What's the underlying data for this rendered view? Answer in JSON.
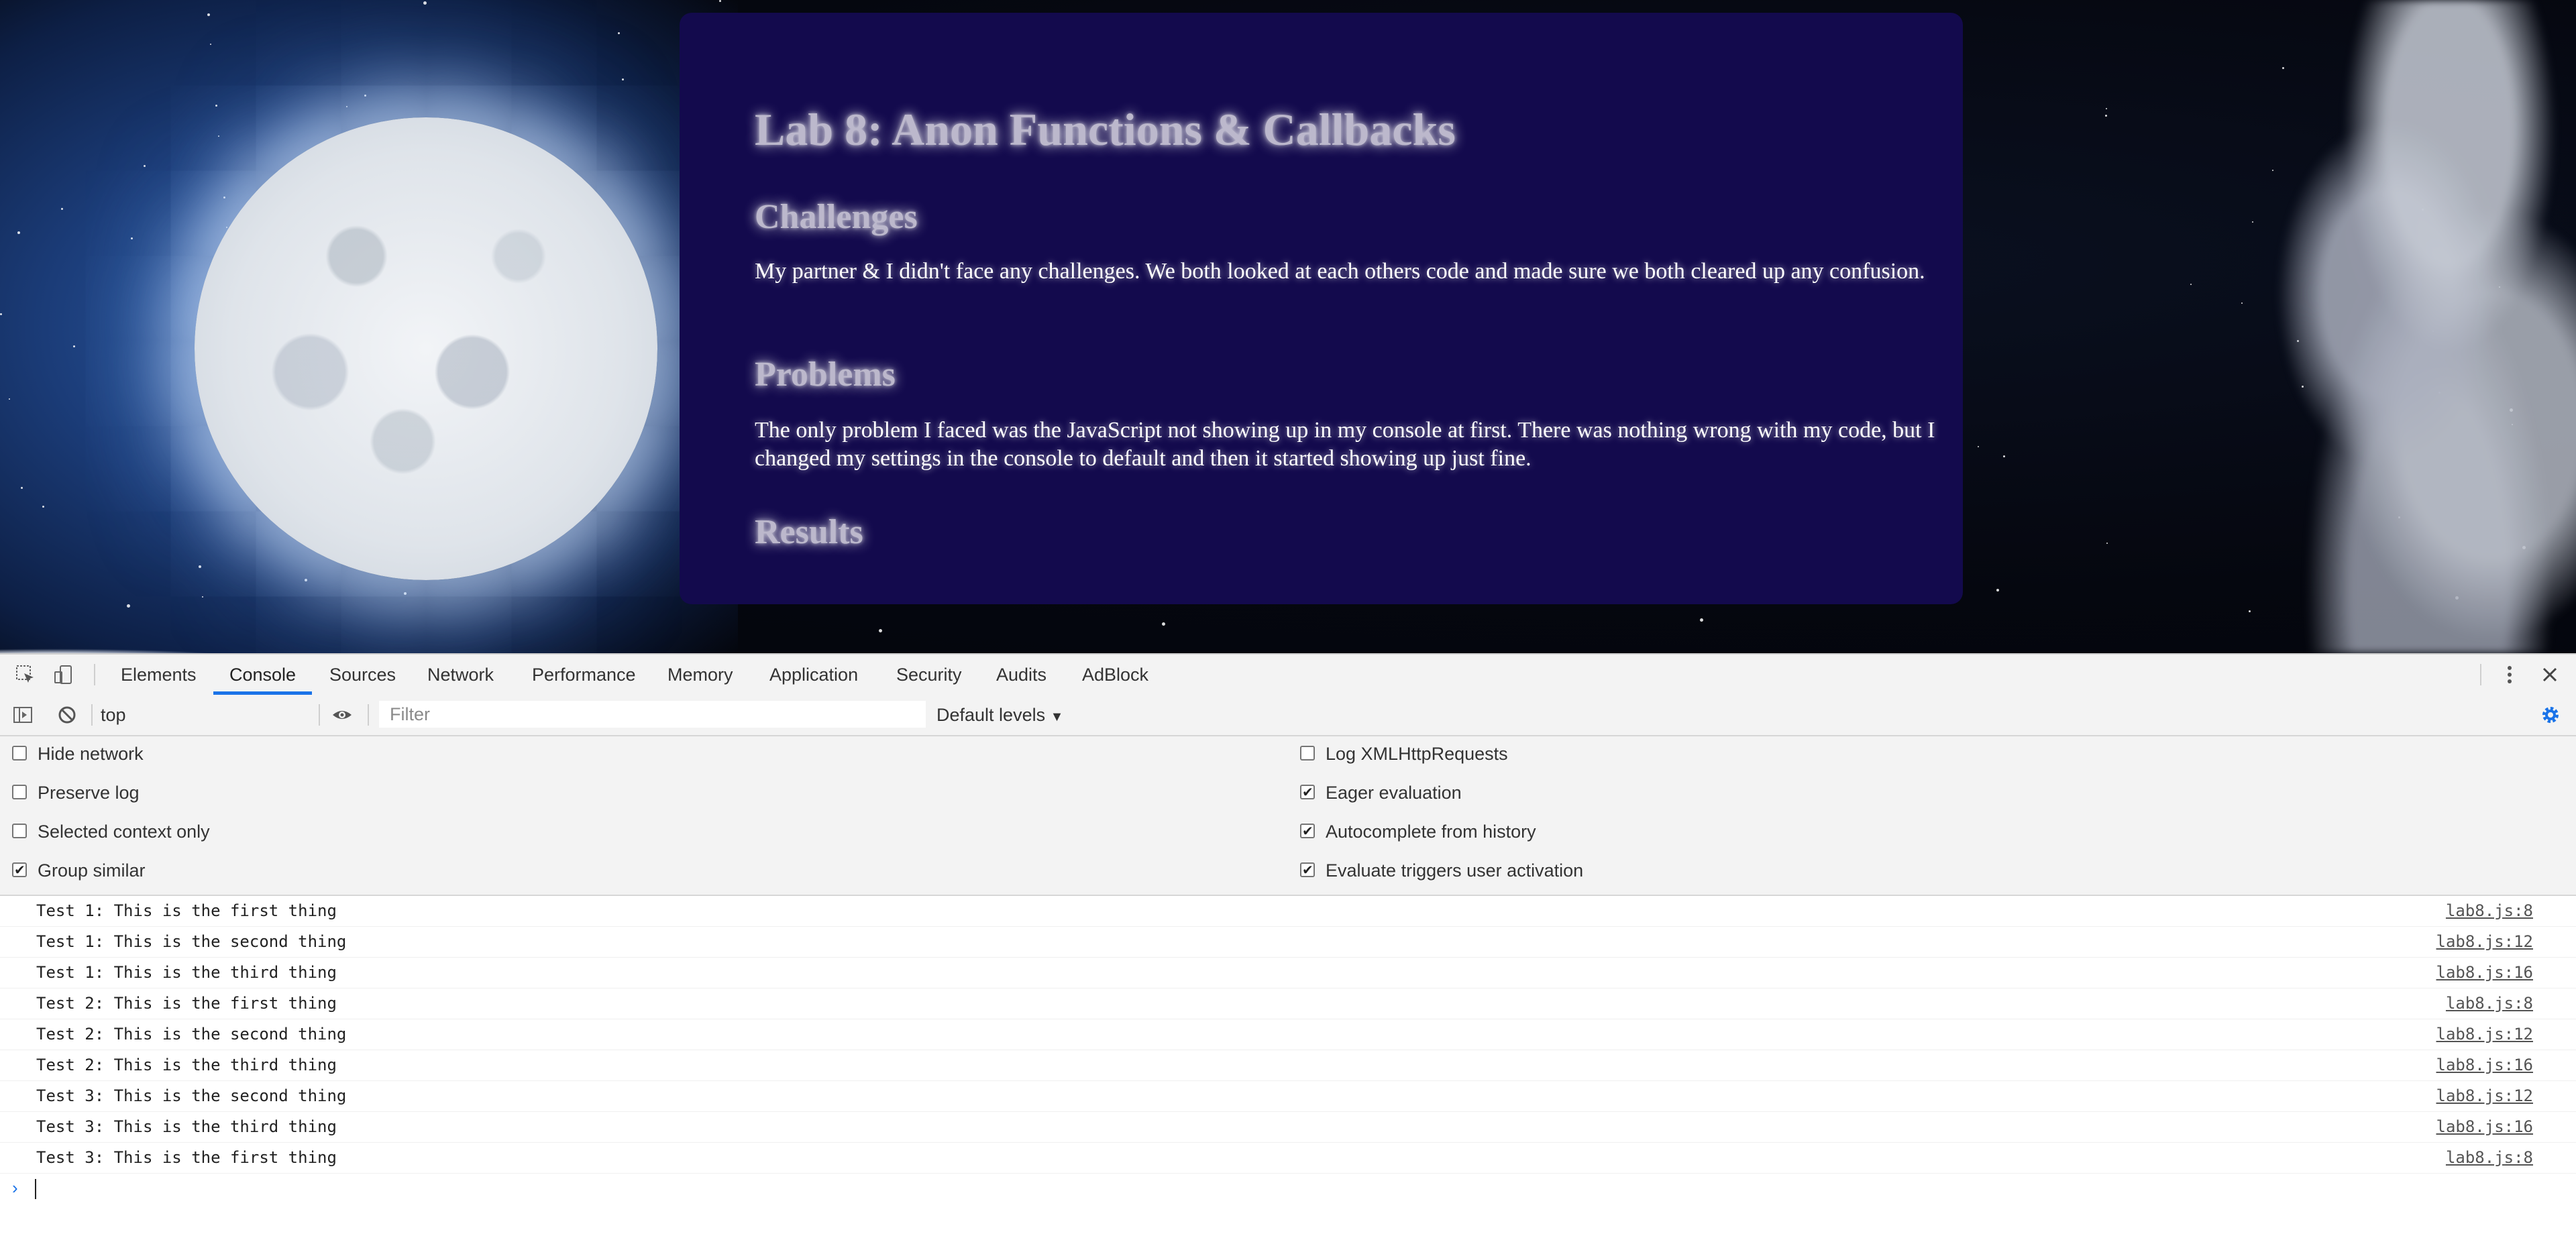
{
  "page": {
    "title": "Lab 8: Anon Functions & Callbacks",
    "sections": [
      {
        "heading": "Challenges",
        "text": "My partner & I didn't face any challenges. We both looked at each others code and made sure we both cleared up any confusion."
      },
      {
        "heading": "Problems",
        "text": "The only problem I faced was the JavaScript not showing up in my console at first. There was nothing wrong with my code, but I changed my settings in the console to default and then it started showing up just fine."
      },
      {
        "heading": "Results",
        "text": ""
      }
    ]
  },
  "devtools": {
    "tabs": [
      "Elements",
      "Console",
      "Sources",
      "Network",
      "Performance",
      "Memory",
      "Application",
      "Security",
      "Audits",
      "AdBlock"
    ],
    "active_tab": "Console",
    "context": "top",
    "filter_placeholder": "Filter",
    "levels_label": "Default levels",
    "settings_left": [
      {
        "label": "Hide network",
        "checked": false
      },
      {
        "label": "Preserve log",
        "checked": false
      },
      {
        "label": "Selected context only",
        "checked": false
      },
      {
        "label": "Group similar",
        "checked": true
      }
    ],
    "settings_right": [
      {
        "label": "Log XMLHttpRequests",
        "checked": false
      },
      {
        "label": "Eager evaluation",
        "checked": true
      },
      {
        "label": "Autocomplete from history",
        "checked": true
      },
      {
        "label": "Evaluate triggers user activation",
        "checked": true
      }
    ],
    "logs": [
      {
        "msg": "Test 1: This is the first thing",
        "src": "lab8.js:8"
      },
      {
        "msg": "Test 1: This is the second thing",
        "src": "lab8.js:12"
      },
      {
        "msg": "Test 1: This is the third thing",
        "src": "lab8.js:16"
      },
      {
        "msg": "Test 2: This is the first thing",
        "src": "lab8.js:8"
      },
      {
        "msg": "Test 2: This is the second thing",
        "src": "lab8.js:12"
      },
      {
        "msg": "Test 2: This is the third thing",
        "src": "lab8.js:16"
      },
      {
        "msg": "Test 3: This is the second thing",
        "src": "lab8.js:12"
      },
      {
        "msg": "Test 3: This is the third thing",
        "src": "lab8.js:16"
      },
      {
        "msg": "Test 3: This is the first thing",
        "src": "lab8.js:8"
      }
    ],
    "prompt_symbol": "›",
    "icons": {
      "inspect": "inspect-element-icon",
      "device": "device-toolbar-icon",
      "more": "more-vert-icon",
      "close": "close-icon",
      "sidebar": "show-sidebar-icon",
      "clear": "clear-console-icon",
      "eye": "live-expression-icon",
      "gear": "gear-icon"
    },
    "accent_color": "#1a73e8"
  }
}
